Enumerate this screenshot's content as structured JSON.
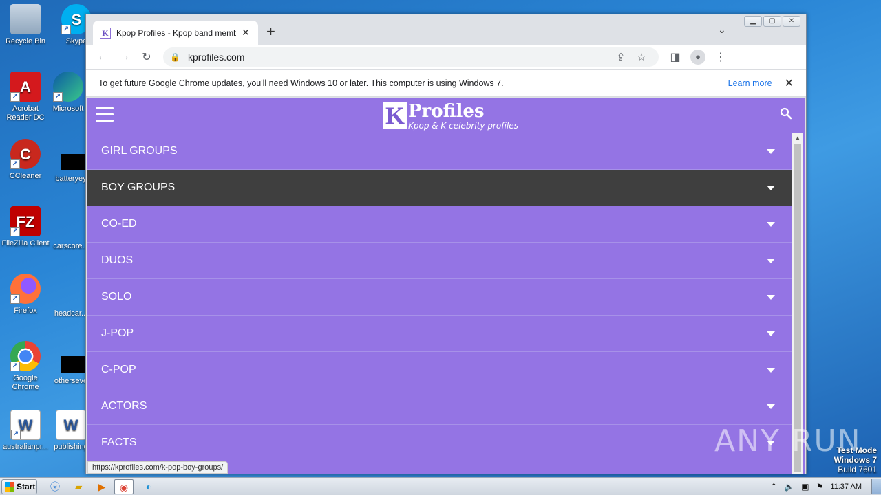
{
  "desktop": {
    "icons": [
      {
        "label": "Recycle Bin"
      },
      {
        "label": "Skype"
      },
      {
        "label": "Acrobat Reader DC"
      },
      {
        "label": "Microsoft"
      },
      {
        "label": "CCleaner"
      },
      {
        "label": "batteryey"
      },
      {
        "label": "FileZilla Client"
      },
      {
        "label": "carscore..."
      },
      {
        "label": "Firefox"
      },
      {
        "label": "headcar..."
      },
      {
        "label": "Google Chrome"
      },
      {
        "label": "otherseve"
      },
      {
        "label": "australianpr..."
      },
      {
        "label": "publishing"
      }
    ],
    "watermark": "ANY RUN",
    "test_mode": {
      "line1": "Test Mode",
      "line2": "Windows 7",
      "line3": "Build 7601"
    }
  },
  "browser": {
    "tab": {
      "favicon": "K",
      "title": "Kpop Profiles - Kpop band member p",
      "close": "✕"
    },
    "new_tab": "+",
    "tab_menu": "⌄",
    "window_controls": {
      "minimize": "▁",
      "maximize": "▢",
      "close": "✕"
    },
    "toolbar": {
      "back": "←",
      "forward": "→",
      "reload": "↻",
      "url": "kprofiles.com",
      "lock": "🔒"
    },
    "infobar": {
      "message": "To get future Google Chrome updates, you'll need Windows 10 or later. This computer is using Windows 7.",
      "link": "Learn more",
      "close": "✕"
    },
    "status_url": "https://kprofiles.com/k-pop-boy-groups/"
  },
  "site": {
    "logo": {
      "k": "K",
      "word": "Profiles",
      "tagline": "Kpop & K celebrity profiles"
    },
    "menu": [
      {
        "label": "GIRL GROUPS",
        "active": false
      },
      {
        "label": "BOY GROUPS",
        "active": true
      },
      {
        "label": "CO-ED",
        "active": false
      },
      {
        "label": "DUOS",
        "active": false
      },
      {
        "label": "SOLO",
        "active": false
      },
      {
        "label": "J-POP",
        "active": false
      },
      {
        "label": "C-POP",
        "active": false
      },
      {
        "label": "ACTORS",
        "active": false
      },
      {
        "label": "FACTS",
        "active": false
      }
    ],
    "colors": {
      "brand": "#9474e4",
      "active_item": "#3f3f3f"
    }
  },
  "taskbar": {
    "start": "Start",
    "clock": "11:37 AM"
  }
}
